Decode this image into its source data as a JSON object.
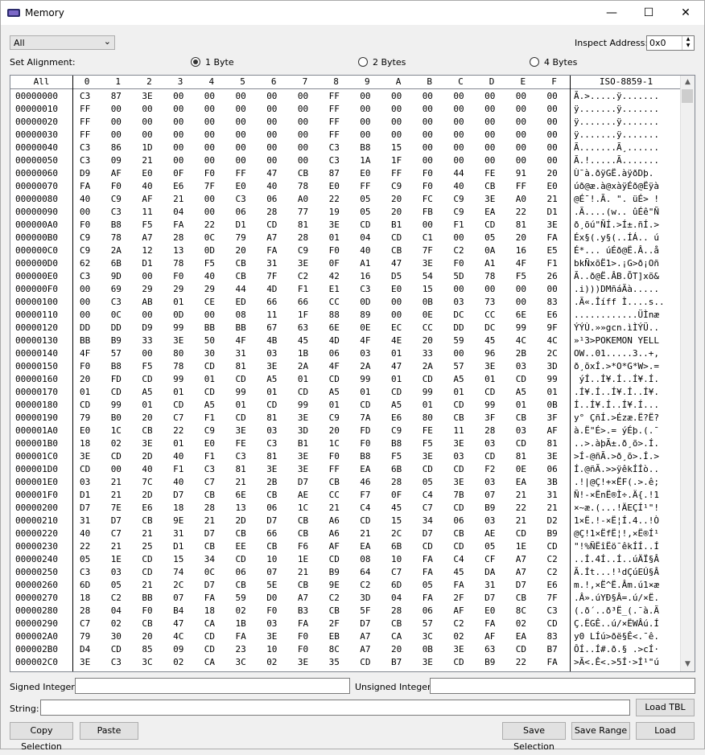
{
  "window": {
    "title": "Memory",
    "minimize": "—",
    "maximize": "☐",
    "close": "✕"
  },
  "toolbar": {
    "region_select": "All",
    "inspect_label": "Inspect Address:",
    "inspect_value": "0x0",
    "alignment_label": "Set Alignment:",
    "alignment_options": [
      "1 Byte",
      "2 Bytes",
      "4 Bytes"
    ],
    "alignment_selected": 0
  },
  "grid": {
    "header_first": "All",
    "header_cols": [
      "0",
      "1",
      "2",
      "3",
      "4",
      "5",
      "6",
      "7",
      "8",
      "9",
      "A",
      "B",
      "C",
      "D",
      "E",
      "F"
    ],
    "header_last": "ISO-8859-1",
    "rows": [
      {
        "addr": "00000000",
        "bytes": [
          "C3",
          "87",
          "3E",
          "00",
          "00",
          "00",
          "00",
          "00",
          "FF",
          "00",
          "00",
          "00",
          "00",
          "00",
          "00",
          "00"
        ],
        "text": "Ã.>.....ÿ......."
      },
      {
        "addr": "00000010",
        "bytes": [
          "FF",
          "00",
          "00",
          "00",
          "00",
          "00",
          "00",
          "00",
          "FF",
          "00",
          "00",
          "00",
          "00",
          "00",
          "00",
          "00"
        ],
        "text": "ÿ.......ÿ......."
      },
      {
        "addr": "00000020",
        "bytes": [
          "FF",
          "00",
          "00",
          "00",
          "00",
          "00",
          "00",
          "00",
          "FF",
          "00",
          "00",
          "00",
          "00",
          "00",
          "00",
          "00"
        ],
        "text": "ÿ.......ÿ......."
      },
      {
        "addr": "00000030",
        "bytes": [
          "FF",
          "00",
          "00",
          "00",
          "00",
          "00",
          "00",
          "00",
          "FF",
          "00",
          "00",
          "00",
          "00",
          "00",
          "00",
          "00"
        ],
        "text": "ÿ.......ÿ......."
      },
      {
        "addr": "00000040",
        "bytes": [
          "C3",
          "86",
          "1D",
          "00",
          "00",
          "00",
          "00",
          "00",
          "C3",
          "B8",
          "15",
          "00",
          "00",
          "00",
          "00",
          "00"
        ],
        "text": "Ã.......Ã¸......"
      },
      {
        "addr": "00000050",
        "bytes": [
          "C3",
          "09",
          "21",
          "00",
          "00",
          "00",
          "00",
          "00",
          "C3",
          "1A",
          "1F",
          "00",
          "00",
          "00",
          "00",
          "00"
        ],
        "text": "Ã.!.....Ã......."
      },
      {
        "addr": "00000060",
        "bytes": [
          "D9",
          "AF",
          "E0",
          "0F",
          "F0",
          "FF",
          "47",
          "CB",
          "87",
          "E0",
          "FF",
          "F0",
          "44",
          "FE",
          "91",
          "20"
        ],
        "text": "Ù¯à.ðÿGË.àÿðDþ. "
      },
      {
        "addr": "00000070",
        "bytes": [
          "FA",
          "F0",
          "40",
          "E6",
          "7F",
          "E0",
          "40",
          "78",
          "E0",
          "FF",
          "C9",
          "F0",
          "40",
          "CB",
          "FF",
          "E0"
        ],
        "text": "úð@æ.à@xàÿÉð@Ëÿà"
      },
      {
        "addr": "00000080",
        "bytes": [
          "40",
          "C9",
          "AF",
          "21",
          "00",
          "C3",
          "06",
          "A0",
          "22",
          "05",
          "20",
          "FC",
          "C9",
          "3E",
          "A0",
          "21"
        ],
        "text": "@É¯!.Ã. \". üÉ> !"
      },
      {
        "addr": "00000090",
        "bytes": [
          "00",
          "C3",
          "11",
          "04",
          "00",
          "06",
          "28",
          "77",
          "19",
          "05",
          "20",
          "FB",
          "C9",
          "EA",
          "22",
          "D1"
        ],
        "text": ".Ã....(w.. ûÉê\"Ñ"
      },
      {
        "addr": "000000A0",
        "bytes": [
          "F0",
          "B8",
          "F5",
          "FA",
          "22",
          "D1",
          "CD",
          "81",
          "3E",
          "CD",
          "B1",
          "00",
          "F1",
          "CD",
          "81",
          "3E"
        ],
        "text": "ð¸õú\"ÑÍ.>Í±.ñÍ.>"
      },
      {
        "addr": "000000B0",
        "bytes": [
          "C9",
          "78",
          "A7",
          "28",
          "0C",
          "79",
          "A7",
          "28",
          "01",
          "04",
          "CD",
          "C1",
          "00",
          "05",
          "20",
          "FA"
        ],
        "text": "Éx§(.y§(..ÍÁ.. ú"
      },
      {
        "addr": "000000C0",
        "bytes": [
          "C9",
          "2A",
          "12",
          "13",
          "0D",
          "20",
          "FA",
          "C9",
          "F0",
          "40",
          "CB",
          "7F",
          "C2",
          "0A",
          "16",
          "E5"
        ],
        "text": "É*... úÉð@Ë.Â..å"
      },
      {
        "addr": "000000D0",
        "bytes": [
          "62",
          "6B",
          "D1",
          "78",
          "F5",
          "CB",
          "31",
          "3E",
          "0F",
          "A1",
          "47",
          "3E",
          "F0",
          "A1",
          "4F",
          "F1"
        ],
        "text": "bkÑxõË1>.¡G>ð¡Oñ"
      },
      {
        "addr": "000000E0",
        "bytes": [
          "C3",
          "9D",
          "00",
          "F0",
          "40",
          "CB",
          "7F",
          "C2",
          "42",
          "16",
          "D5",
          "54",
          "5D",
          "78",
          "F5",
          "26"
        ],
        "text": "Ã..ð@Ë.ÂB.ÕT]xõ&"
      },
      {
        "addr": "000000F0",
        "bytes": [
          "00",
          "69",
          "29",
          "29",
          "29",
          "44",
          "4D",
          "F1",
          "E1",
          "C3",
          "E0",
          "15",
          "00",
          "00",
          "00",
          "00"
        ],
        "text": ".i)))DMñáÃà....."
      },
      {
        "addr": "00000100",
        "bytes": [
          "00",
          "C3",
          "AB",
          "01",
          "CE",
          "ED",
          "66",
          "66",
          "CC",
          "0D",
          "00",
          "0B",
          "03",
          "73",
          "00",
          "83"
        ],
        "text": ".Ã«.Îíff Ì....s.."
      },
      {
        "addr": "00000110",
        "bytes": [
          "00",
          "0C",
          "00",
          "0D",
          "00",
          "08",
          "11",
          "1F",
          "88",
          "89",
          "00",
          "0E",
          "DC",
          "CC",
          "6E",
          "E6"
        ],
        "text": "............ÜÌnæ"
      },
      {
        "addr": "00000120",
        "bytes": [
          "DD",
          "DD",
          "D9",
          "99",
          "BB",
          "BB",
          "67",
          "63",
          "6E",
          "0E",
          "EC",
          "CC",
          "DD",
          "DC",
          "99",
          "9F"
        ],
        "text": "ÝÝÙ.»»gcn.ìÌÝÜ.."
      },
      {
        "addr": "00000130",
        "bytes": [
          "BB",
          "B9",
          "33",
          "3E",
          "50",
          "4F",
          "4B",
          "45",
          "4D",
          "4F",
          "4E",
          "20",
          "59",
          "45",
          "4C",
          "4C"
        ],
        "text": "»¹3>POKEMON YELL"
      },
      {
        "addr": "00000140",
        "bytes": [
          "4F",
          "57",
          "00",
          "80",
          "30",
          "31",
          "03",
          "1B",
          "06",
          "03",
          "01",
          "33",
          "00",
          "96",
          "2B",
          "2C"
        ],
        "text": "OW..01.....3..+,"
      },
      {
        "addr": "00000150",
        "bytes": [
          "F0",
          "B8",
          "F5",
          "78",
          "CD",
          "81",
          "3E",
          "2A",
          "4F",
          "2A",
          "47",
          "2A",
          "57",
          "3E",
          "03",
          "3D"
        ],
        "text": "ð¸õxÍ.>*O*G*W>.="
      },
      {
        "addr": "00000160",
        "bytes": [
          "20",
          "FD",
          "CD",
          "99",
          "01",
          "CD",
          "A5",
          "01",
          "CD",
          "99",
          "01",
          "CD",
          "A5",
          "01",
          "CD",
          "99"
        ],
        "text": " ýÍ..Í¥.Í..Í¥.Í."
      },
      {
        "addr": "00000170",
        "bytes": [
          "01",
          "CD",
          "A5",
          "01",
          "CD",
          "99",
          "01",
          "CD",
          "A5",
          "01",
          "CD",
          "99",
          "01",
          "CD",
          "A5",
          "01"
        ],
        "text": ".Í¥.Í..Í¥.Í..Í¥."
      },
      {
        "addr": "00000180",
        "bytes": [
          "CD",
          "99",
          "01",
          "CD",
          "A5",
          "01",
          "CD",
          "99",
          "01",
          "CD",
          "A5",
          "01",
          "CD",
          "99",
          "01",
          "0B"
        ],
        "text": "Í..Í¥.Í..Í¥.Í..."
      },
      {
        "addr": "00000190",
        "bytes": [
          "79",
          "B0",
          "20",
          "C7",
          "F1",
          "CD",
          "81",
          "3E",
          "C9",
          "7A",
          "E6",
          "80",
          "CB",
          "3F",
          "CB",
          "3F"
        ],
        "text": "y° ÇñÍ.>Ézæ.Ë?Ë?"
      },
      {
        "addr": "000001A0",
        "bytes": [
          "E0",
          "1C",
          "CB",
          "22",
          "C9",
          "3E",
          "03",
          "3D",
          "20",
          "FD",
          "C9",
          "FE",
          "11",
          "28",
          "03",
          "AF"
        ],
        "text": "à.Ë\"É>.= ýÉþ.(.¯"
      },
      {
        "addr": "000001B0",
        "bytes": [
          "18",
          "02",
          "3E",
          "01",
          "E0",
          "FE",
          "C3",
          "B1",
          "1C",
          "F0",
          "B8",
          "F5",
          "3E",
          "03",
          "CD",
          "81"
        ],
        "text": "..>.àþÃ±.ð¸õ>.Í."
      },
      {
        "addr": "000001C0",
        "bytes": [
          "3E",
          "CD",
          "2D",
          "40",
          "F1",
          "C3",
          "81",
          "3E",
          "F0",
          "B8",
          "F5",
          "3E",
          "03",
          "CD",
          "81",
          "3E"
        ],
        "text": ">Í-@ñÃ.>ð¸õ>.Í.>"
      },
      {
        "addr": "000001D0",
        "bytes": [
          "CD",
          "00",
          "40",
          "F1",
          "C3",
          "81",
          "3E",
          "3E",
          "FF",
          "EA",
          "6B",
          "CD",
          "CD",
          "F2",
          "0E",
          "06"
        ],
        "text": "Í.@ñÃ.>>ÿêkÍÍò.."
      },
      {
        "addr": "000001E0",
        "bytes": [
          "03",
          "21",
          "7C",
          "40",
          "C7",
          "21",
          "2B",
          "D7",
          "CB",
          "46",
          "28",
          "05",
          "3E",
          "03",
          "EA",
          "3B"
        ],
        "text": ".!|@Ç!+×ËF(.>.ê;"
      },
      {
        "addr": "000001F0",
        "bytes": [
          "D1",
          "21",
          "2D",
          "D7",
          "CB",
          "6E",
          "CB",
          "AE",
          "CC",
          "F7",
          "0F",
          "C4",
          "7B",
          "07",
          "21",
          "31"
        ],
        "text": "Ñ!-×ËnË®Ì÷.Ä{.!1"
      },
      {
        "addr": "00000200",
        "bytes": [
          "D7",
          "7E",
          "E6",
          "18",
          "28",
          "13",
          "06",
          "1C",
          "21",
          "C4",
          "45",
          "C7",
          "CD",
          "B9",
          "22",
          "21"
        ],
        "text": "×~æ.(...!ÄEÇÍ¹\"!"
      },
      {
        "addr": "00000210",
        "bytes": [
          "31",
          "D7",
          "CB",
          "9E",
          "21",
          "2D",
          "D7",
          "CB",
          "A6",
          "CD",
          "15",
          "34",
          "06",
          "03",
          "21",
          "D2"
        ],
        "text": "1×Ë.!-×Ë¦Í.4..!Ò"
      },
      {
        "addr": "00000220",
        "bytes": [
          "40",
          "C7",
          "21",
          "31",
          "D7",
          "CB",
          "66",
          "CB",
          "A6",
          "21",
          "2C",
          "D7",
          "CB",
          "AE",
          "CD",
          "B9"
        ],
        "text": "@Ç!1×ËfË¦!,×Ë®Í¹"
      },
      {
        "addr": "00000230",
        "bytes": [
          "22",
          "21",
          "25",
          "D1",
          "CB",
          "EE",
          "CB",
          "F6",
          "AF",
          "EA",
          "6B",
          "CD",
          "CD",
          "05",
          "1E",
          "CD"
        ],
        "text": "\"!%ÑËîËö¯êkÍÍ..Í"
      },
      {
        "addr": "00000240",
        "bytes": [
          "05",
          "1E",
          "CD",
          "15",
          "34",
          "CD",
          "10",
          "1E",
          "CD",
          "08",
          "10",
          "FA",
          "C4",
          "CF",
          "A7",
          "C2"
        ],
        "text": "..Í.4Í..Í..úÄÏ§Â"
      },
      {
        "addr": "00000250",
        "bytes": [
          "C3",
          "03",
          "CD",
          "74",
          "0C",
          "06",
          "07",
          "21",
          "B9",
          "64",
          "C7",
          "FA",
          "45",
          "DA",
          "A7",
          "C2"
        ],
        "text": "Ã.Ít...!¹dÇúEÚ§Â"
      },
      {
        "addr": "00000260",
        "bytes": [
          "6D",
          "05",
          "21",
          "2C",
          "D7",
          "CB",
          "5E",
          "CB",
          "9E",
          "C2",
          "6D",
          "05",
          "FA",
          "31",
          "D7",
          "E6"
        ],
        "text": "m.!,×Ë^Ë.Âm.ú1×æ"
      },
      {
        "addr": "00000270",
        "bytes": [
          "18",
          "C2",
          "BB",
          "07",
          "FA",
          "59",
          "D0",
          "A7",
          "C2",
          "3D",
          "04",
          "FA",
          "2F",
          "D7",
          "CB",
          "7F"
        ],
        "text": ".Â».úYÐ§Â=.ú/×Ë."
      },
      {
        "addr": "00000280",
        "bytes": [
          "28",
          "04",
          "F0",
          "B4",
          "18",
          "02",
          "F0",
          "B3",
          "CB",
          "5F",
          "28",
          "06",
          "AF",
          "E0",
          "8C",
          "C3"
        ],
        "text": "(.ð´..ð³Ë_(.¯à.Ã"
      },
      {
        "addr": "00000290",
        "bytes": [
          "C7",
          "02",
          "CB",
          "47",
          "CA",
          "1B",
          "03",
          "FA",
          "2F",
          "D7",
          "CB",
          "57",
          "C2",
          "FA",
          "02",
          "CD"
        ],
        "text": "Ç.ËGÊ..ú/×ËWÂú.Í"
      },
      {
        "addr": "000002A0",
        "bytes": [
          "79",
          "30",
          "20",
          "4C",
          "CD",
          "FA",
          "3E",
          "F0",
          "EB",
          "A7",
          "CA",
          "3C",
          "02",
          "AF",
          "EA",
          "83"
        ],
        "text": "y0 LÍú>ðë§Ê<.¯ê."
      },
      {
        "addr": "000002B0",
        "bytes": [
          "D4",
          "CD",
          "85",
          "09",
          "CD",
          "23",
          "10",
          "F0",
          "8C",
          "A7",
          "20",
          "0B",
          "3E",
          "63",
          "CD",
          "B7"
        ],
        "text": "ÔÍ..Í#.ð.§ .>cÍ·"
      },
      {
        "addr": "000002C0",
        "bytes": [
          "3E",
          "C3",
          "3C",
          "02",
          "CA",
          "3C",
          "02",
          "3E",
          "35",
          "CD",
          "B7",
          "3E",
          "CD",
          "B9",
          "22",
          "FA"
        ],
        "text": ">Ã<.Ê<.>5Í·>Í¹\"ú"
      }
    ]
  },
  "fields": {
    "signed_label": "Signed Integer:",
    "unsigned_label": "Unsigned Integer:",
    "string_label": "String:",
    "signed_value": "",
    "unsigned_value": "",
    "string_value": ""
  },
  "buttons": {
    "load_tbl": "Load TBL",
    "copy_selection": "Copy Selection",
    "paste": "Paste",
    "save_selection": "Save Selection",
    "save_range": "Save Range",
    "load": "Load"
  },
  "colors": {
    "border": "#828790",
    "button_bg": "#e1e1e1",
    "window_bg": "#f0f0f0"
  }
}
